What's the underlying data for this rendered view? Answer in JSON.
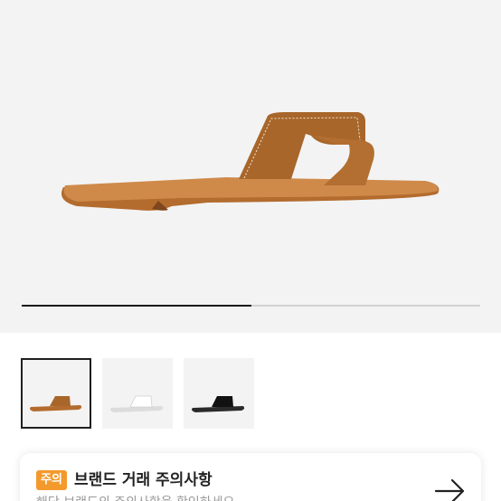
{
  "gallery": {
    "main_image_alt": "brown leather slide sandal",
    "progress": 0.5,
    "thumbnails": [
      {
        "alt": "brown sandal",
        "color": "#a8662a",
        "selected": true
      },
      {
        "alt": "white sandal",
        "color": "#f2f2f2",
        "selected": false
      },
      {
        "alt": "black sandal",
        "color": "#1c1c1c",
        "selected": false
      }
    ]
  },
  "notice": {
    "badge": "주의",
    "title": "브랜드 거래 주의사항",
    "subtitle": "해당 브랜드의 주의사항을 확인하세요",
    "icon": "arrow-right-icon",
    "accent_color": "#f39a2d"
  }
}
